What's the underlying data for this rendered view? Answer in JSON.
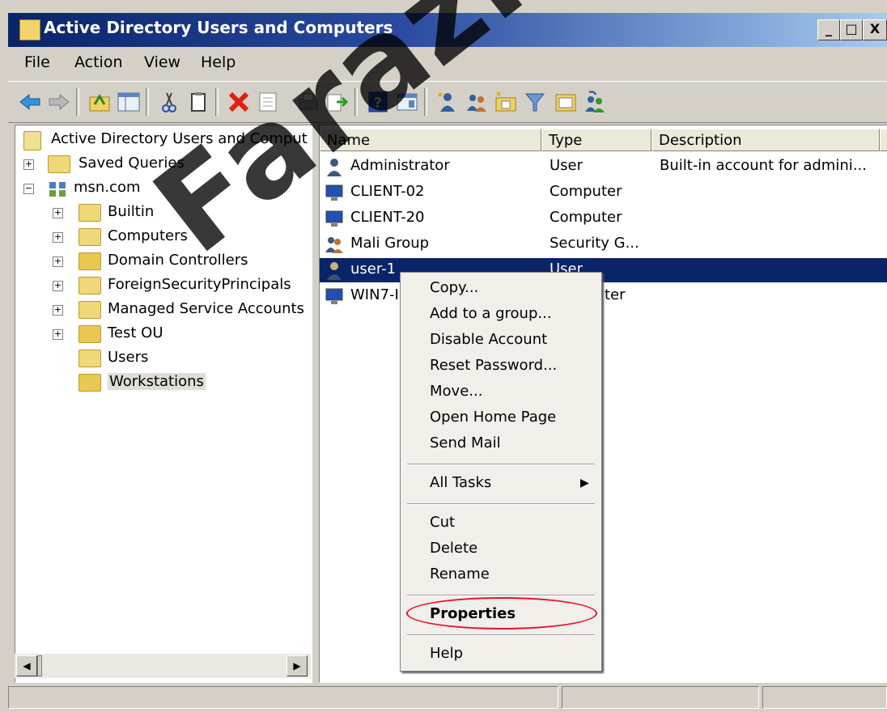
{
  "window": {
    "title": "Active Directory Users and Computers",
    "minimize_glyph": "_",
    "maximize_glyph": "□",
    "close_glyph": "X"
  },
  "menubar": [
    "File",
    "Action",
    "View",
    "Help"
  ],
  "toolbar": {
    "icons": [
      "back-icon",
      "forward-icon",
      "up-folder-icon",
      "show-hide-tree-icon",
      "cut-icon",
      "copy-icon",
      "delete-icon",
      "properties-icon",
      "print-icon",
      "export-list-icon",
      "help-icon",
      "console-view-icon",
      "new-user-icon",
      "new-group-icon",
      "new-ou-icon",
      "filter-icon",
      "find-icon",
      "add-to-group-icon"
    ]
  },
  "tree": {
    "root": "Active Directory Users and Comput",
    "items": [
      {
        "label": "Saved Queries",
        "expander": "+"
      },
      {
        "label": "msn.com",
        "expander": "−"
      },
      {
        "label": "Builtin",
        "expander": "+"
      },
      {
        "label": "Computers",
        "expander": "+"
      },
      {
        "label": "Domain Controllers",
        "expander": "+"
      },
      {
        "label": "ForeignSecurityPrincipals",
        "expander": "+"
      },
      {
        "label": "Managed Service Accounts",
        "expander": "+"
      },
      {
        "label": "Test OU",
        "expander": "+"
      },
      {
        "label": "Users",
        "expander": ""
      },
      {
        "label": "Workstations",
        "expander": ""
      }
    ]
  },
  "list": {
    "columns": [
      "Name",
      "Type",
      "Description"
    ],
    "rows": [
      {
        "name": "Administrator",
        "type": "User",
        "description": "Built-in account for admini...",
        "icon": "user-icon"
      },
      {
        "name": "CLIENT-02",
        "type": "Computer",
        "description": "",
        "icon": "computer-icon"
      },
      {
        "name": "CLIENT-20",
        "type": "Computer",
        "description": "",
        "icon": "computer-icon"
      },
      {
        "name": "Mali Group",
        "type": "Security G...",
        "description": "",
        "icon": "group-icon"
      },
      {
        "name": "user-1",
        "type": "User",
        "description": "",
        "icon": "user-icon"
      },
      {
        "name": "WIN7-I",
        "type": "ter",
        "description": "",
        "icon": "computer-icon"
      }
    ]
  },
  "context_menu": {
    "group1": [
      "Copy...",
      "Add to a group...",
      "Disable Account",
      "Reset Password...",
      "Move...",
      "Open Home Page",
      "Send Mail"
    ],
    "all_tasks": "All Tasks",
    "submenu_arrow": "▶",
    "group3": [
      "Cut",
      "Delete",
      "Rename"
    ],
    "properties": "Properties",
    "help": "Help"
  },
  "scrollbar": {
    "left_arrow": "◀",
    "right_arrow": "▶"
  },
  "watermark": "FarazNet",
  "colors": {
    "selection": "#0a246a",
    "highlight_ring": "#e8102a",
    "title_gradient_start": "#0a246a"
  }
}
